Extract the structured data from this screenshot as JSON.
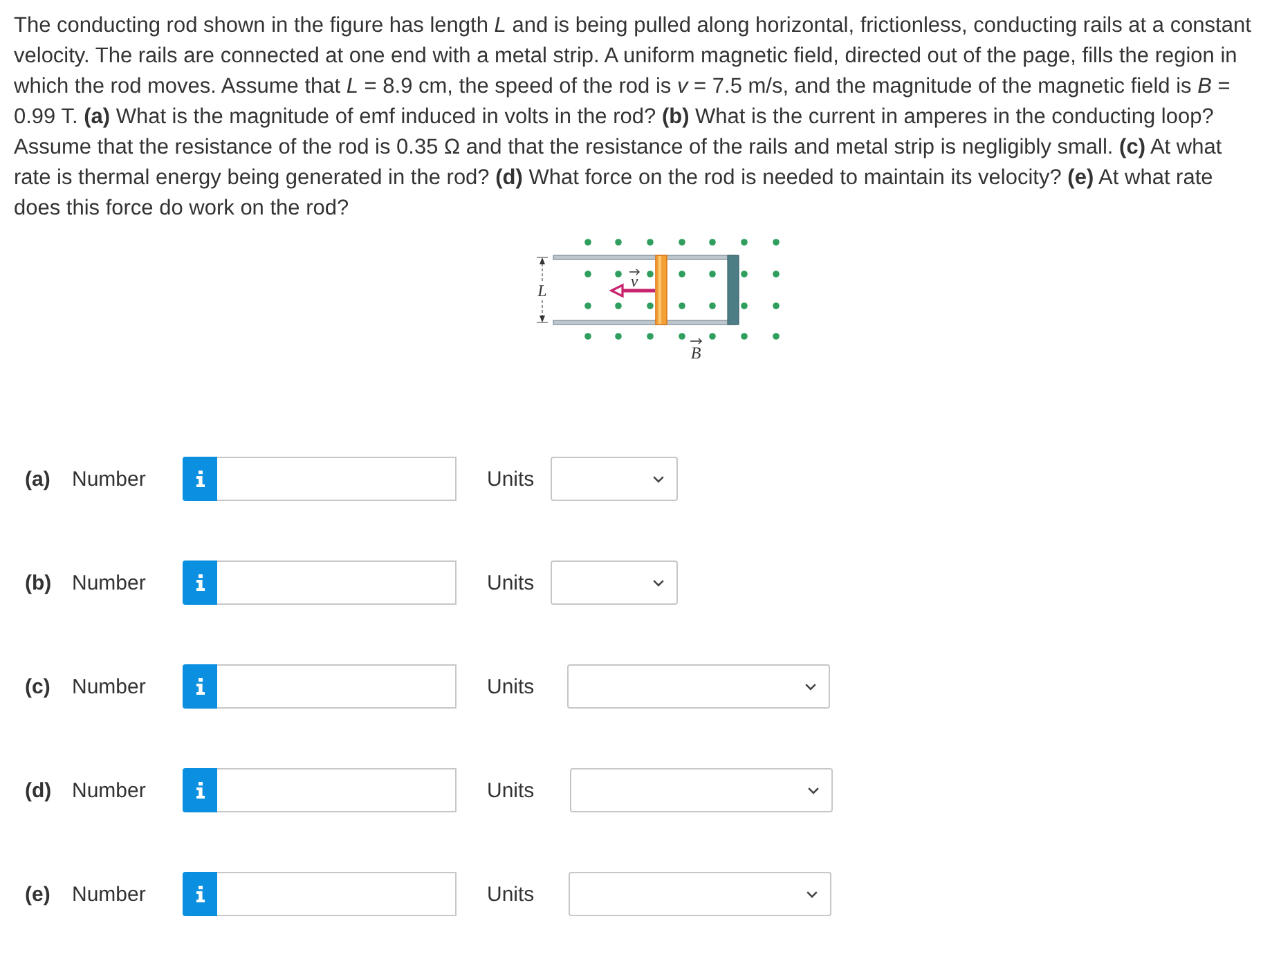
{
  "question": {
    "text": "The conducting rod shown in the figure has length *L* and is being pulled along horizontal, frictionless, conducting rails at a constant velocity. The rails are connected at one end with a metal strip. A uniform magnetic field, directed out of the page, fills the region in which the rod moves. Assume that *L* = 8.9 cm, the speed of the rod is *v* = 7.5 m/s, and the magnitude of the magnetic field is *B* = 0.99 T. **(a)** What is the magnitude of emf induced in volts in the rod? **(b)** What is the current in amperes in the conducting loop? Assume that the resistance of the rod is 0.35 Ω and that the resistance of the rails and metal strip is negligibly small. **(c)** At what rate is thermal energy being generated in the rod? **(d)** What force on the rod is needed to maintain its velocity? **(e)** At what rate does this force do work on the rod?"
  },
  "figure": {
    "length_label": "L",
    "velocity_label": "v",
    "field_label": "B"
  },
  "answers": [
    {
      "part": "(a)",
      "label": "Number",
      "units_label": "Units"
    },
    {
      "part": "(b)",
      "label": "Number",
      "units_label": "Units"
    },
    {
      "part": "(c)",
      "label": "Number",
      "units_label": "Units"
    },
    {
      "part": "(d)",
      "label": "Number",
      "units_label": "Units"
    },
    {
      "part": "(e)",
      "label": "Number",
      "units_label": "Units"
    }
  ]
}
